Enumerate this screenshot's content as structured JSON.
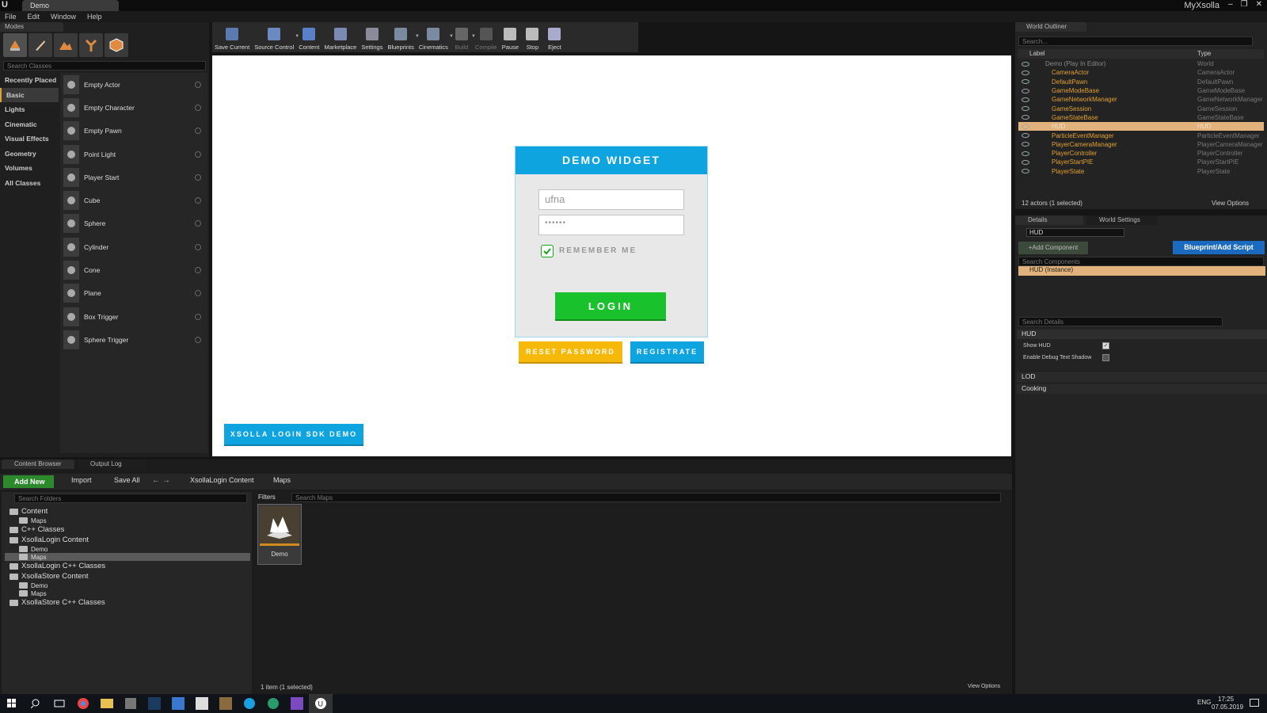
{
  "window": {
    "logo": "U",
    "doc_tab": "Demo",
    "user": "MyXsolla",
    "controls": [
      "–",
      "❐",
      "✕"
    ]
  },
  "menu": [
    "File",
    "Edit",
    "Window",
    "Help"
  ],
  "modes": {
    "tab": "Modes",
    "search_placeholder": "Search Classes",
    "categories": [
      "Recently Placed",
      "Basic",
      "Lights",
      "Cinematic",
      "Visual Effects",
      "Geometry",
      "Volumes",
      "All Classes"
    ],
    "selected_category": "Basic",
    "classes": [
      "Empty Actor",
      "Empty Character",
      "Empty Pawn",
      "Point Light",
      "Player Start",
      "Cube",
      "Sphere",
      "Cylinder",
      "Cone",
      "Plane",
      "Box Trigger",
      "Sphere Trigger"
    ]
  },
  "toolbar": [
    {
      "label": "Save Current",
      "icon": "save-icon"
    },
    {
      "label": "Source Control",
      "icon": "source-control-icon"
    },
    {
      "label": "Content",
      "icon": "content-icon"
    },
    {
      "label": "Marketplace",
      "icon": "marketplace-icon"
    },
    {
      "label": "Settings",
      "icon": "settings-icon"
    },
    {
      "label": "Blueprints",
      "icon": "blueprints-icon"
    },
    {
      "label": "Cinematics",
      "icon": "cinematics-icon"
    },
    {
      "label": "Build",
      "icon": "build-icon"
    },
    {
      "label": "Compile",
      "icon": "compile-icon"
    },
    {
      "label": "Pause",
      "icon": "pause-icon"
    },
    {
      "label": "Stop",
      "icon": "stop-icon"
    },
    {
      "label": "Eject",
      "icon": "eject-icon"
    }
  ],
  "widget": {
    "title": "DEMO WIDGET",
    "username": "ufna",
    "password": "••••••",
    "remember_label": "REMEMBER ME",
    "remember_checked": true,
    "login": "LOGIN",
    "reset": "RESET PASSWORD",
    "register": "REGISTRATE",
    "sdk_demo": "XSOLLA LOGIN SDK DEMO",
    "colors": {
      "blue": "#0da4e0",
      "green": "#19c12d",
      "yellow": "#f6b90a"
    }
  },
  "outliner": {
    "tab": "World Outliner",
    "search_placeholder": "Search...",
    "col_label": "Label",
    "col_type": "Type",
    "rows": [
      {
        "label": "Demo (Play In Editor)",
        "type": "World"
      },
      {
        "label": "CameraActor",
        "type": "CameraActor"
      },
      {
        "label": "DefaultPawn",
        "type": "DefaultPawn"
      },
      {
        "label": "GameModeBase",
        "type": "GameModeBase"
      },
      {
        "label": "GameNetworkManager",
        "type": "GameNetworkManager"
      },
      {
        "label": "GameSession",
        "type": "GameSession"
      },
      {
        "label": "GameStateBase",
        "type": "GameStateBase"
      },
      {
        "label": "HUD",
        "type": "HUD"
      },
      {
        "label": "ParticleEventManager",
        "type": "ParticleEventManager"
      },
      {
        "label": "PlayerCameraManager",
        "type": "PlayerCameraManager"
      },
      {
        "label": "PlayerController",
        "type": "PlayerController"
      },
      {
        "label": "PlayerStartPIE",
        "type": "PlayerStartPIE"
      },
      {
        "label": "PlayerState",
        "type": "PlayerState"
      }
    ],
    "selected": "HUD",
    "status": "12 actors (1 selected)",
    "view_options": "View Options"
  },
  "details": {
    "tabs": [
      "Details",
      "World Settings"
    ],
    "name": "HUD",
    "add_component": "+Add Component",
    "blueprint": "Blueprint/Add Script",
    "search_components": "Search Components",
    "component": "HUD (Instance)",
    "search_details": "Search Details",
    "sections": [
      "HUD",
      "LOD",
      "Cooking"
    ],
    "props": [
      {
        "label": "Show HUD",
        "checked": true
      },
      {
        "label": "Enable Debug Text Shadow",
        "checked": false
      }
    ]
  },
  "content_browser": {
    "tabs": [
      "Content Browser",
      "Output Log"
    ],
    "add_new": "Add New",
    "import": "Import",
    "save_all": "Save All",
    "path": [
      "XsollaLogin Content",
      "Maps"
    ],
    "search_folders": "Search Folders",
    "filters": "Filters",
    "search_maps": "Search Maps",
    "tree": [
      {
        "label": "Content",
        "level": 0,
        "small": false
      },
      {
        "label": "Maps",
        "level": 1,
        "small": true
      },
      {
        "label": "C++ Classes",
        "level": 0,
        "small": false
      },
      {
        "label": "XsollaLogin Content",
        "level": 0,
        "small": false
      },
      {
        "label": "Demo",
        "level": 1,
        "small": true
      },
      {
        "label": "Maps",
        "level": 1,
        "small": true
      },
      {
        "label": "XsollaLogin C++ Classes",
        "level": 0,
        "small": false
      },
      {
        "label": "XsollaStore Content",
        "level": 0,
        "small": false
      },
      {
        "label": "Demo",
        "level": 1,
        "small": true
      },
      {
        "label": "Maps",
        "level": 1,
        "small": true
      },
      {
        "label": "XsollaStore C++ Classes",
        "level": 0,
        "small": false
      }
    ],
    "asset": "Demo",
    "status": "1 item (1 selected)",
    "view_options": "View Options"
  },
  "taskbar": {
    "lang": "ENG",
    "time": "17:25",
    "date": "07.05.2019"
  }
}
